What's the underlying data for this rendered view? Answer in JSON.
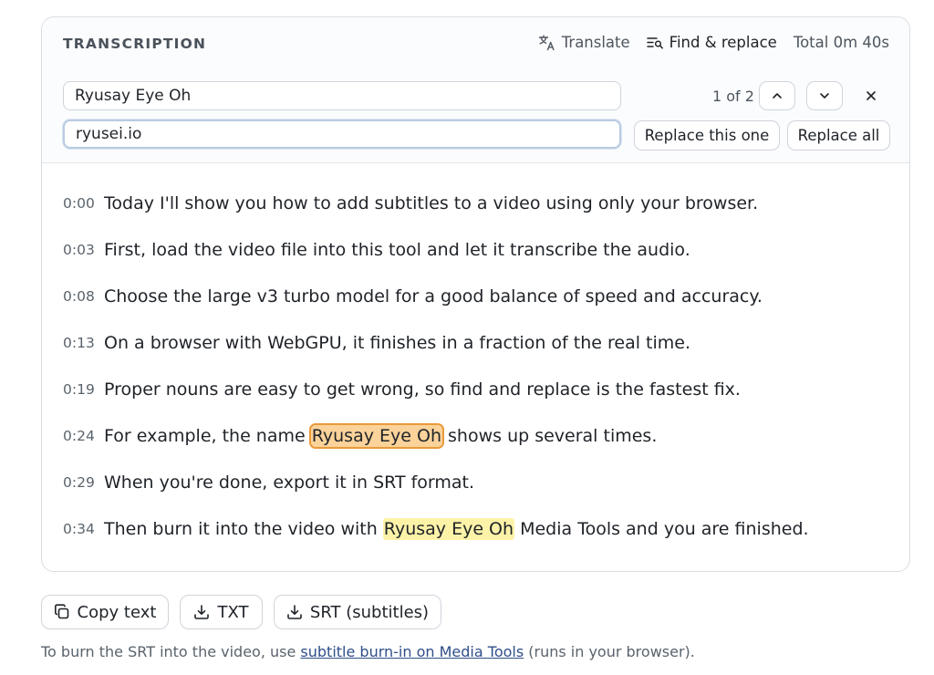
{
  "header": {
    "title": "TRANSCRIPTION",
    "translate_label": "Translate",
    "find_replace_label": "Find & replace",
    "total_label": "Total 0m 40s"
  },
  "find_replace": {
    "find_value": "Ryusay Eye Oh",
    "replace_value": "ryusei.io",
    "match_count": "1 of 2",
    "replace_one_label": "Replace this one",
    "replace_all_label": "Replace all",
    "close_glyph": "✕"
  },
  "transcript": {
    "lines": [
      {
        "time": "0:00",
        "before": "Today I'll show you how to add subtitles to a video using only your browser.",
        "match": "",
        "after": ""
      },
      {
        "time": "0:03",
        "before": "First, load the video file into this tool and let it transcribe the audio.",
        "match": "",
        "after": ""
      },
      {
        "time": "0:08",
        "before": "Choose the large v3 turbo model for a good balance of speed and accuracy.",
        "match": "",
        "after": ""
      },
      {
        "time": "0:13",
        "before": "On a browser with WebGPU, it finishes in a fraction of the real time.",
        "match": "",
        "after": ""
      },
      {
        "time": "0:19",
        "before": "Proper nouns are easy to get wrong, so find and replace is the fastest fix.",
        "match": "",
        "after": ""
      },
      {
        "time": "0:24",
        "before": "For example, the name ",
        "match": "Ryusay Eye Oh",
        "after": " shows up several times.",
        "current": true
      },
      {
        "time": "0:29",
        "before": "When you're done, export it in SRT format.",
        "match": "",
        "after": ""
      },
      {
        "time": "0:34",
        "before": "Then burn it into the video with ",
        "match": "Ryusay Eye Oh",
        "after": " Media Tools and you are finished."
      }
    ]
  },
  "actions": {
    "copy_label": "Copy text",
    "txt_label": "TXT",
    "srt_label": "SRT (subtitles)"
  },
  "footer": {
    "note_before": "To burn the SRT into the video, use ",
    "note_link": "subtitle burn-in on Media Tools",
    "note_after": " (runs in your browser)."
  },
  "colors": {
    "highlight": "#fdf3a8",
    "current_highlight": "#fbd39a",
    "current_outline": "#e99a3a",
    "link": "#2f4e8a"
  },
  "icons": {
    "translate": "translate-icon",
    "find_replace": "find-replace-icon",
    "up": "chevron-up-icon",
    "down": "chevron-down-icon",
    "close": "close-icon",
    "copy": "copy-icon",
    "download": "download-icon"
  }
}
